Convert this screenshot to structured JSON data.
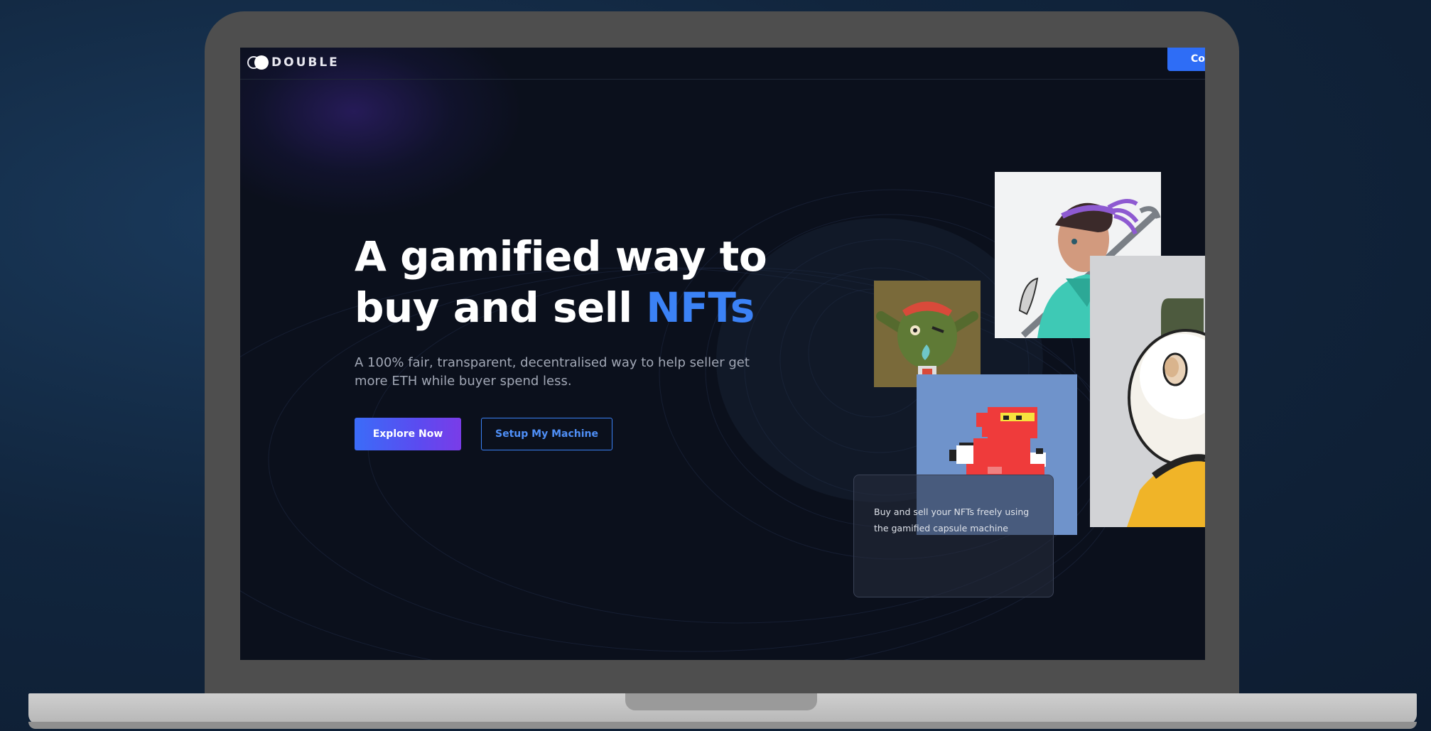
{
  "brand": {
    "name": "DOUBLE"
  },
  "header": {
    "connect_label": "Co"
  },
  "hero": {
    "title_line1": "A gamified way to",
    "title_line2_prefix": "buy and sell ",
    "title_line2_accent": "NFTs",
    "subtitle": "A 100% fair, transparent, decentralised way to help seller get more ETH while buyer spend less.",
    "primary_button": "Explore Now",
    "secondary_button": "Setup My Machine"
  },
  "card": {
    "text": "Buy and sell your NFTs freely using the gamified capsule machine"
  },
  "nfts": [
    {
      "icon": "anime-warrior-image"
    },
    {
      "icon": "goblin-image"
    },
    {
      "icon": "pixel-dragon-image"
    },
    {
      "icon": "ape-image"
    }
  ],
  "colors": {
    "accent": "#3b82f6",
    "background": "#0b101c",
    "primary_gradient_start": "#3b6cf8",
    "primary_gradient_end": "#7a3ce8"
  }
}
